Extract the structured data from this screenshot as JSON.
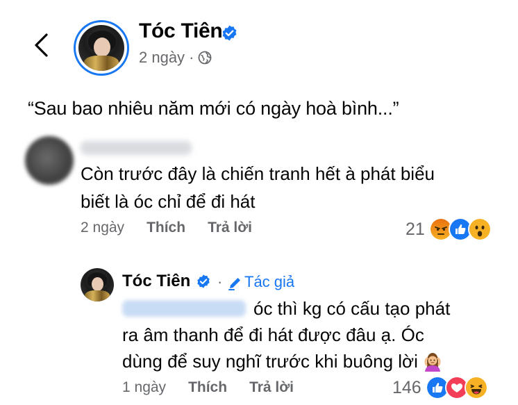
{
  "post": {
    "author": "Tóc Tiên",
    "time": "2 ngày",
    "separator": "·",
    "text": "“Sau bao nhiêu năm mới có ngày hoà bình...”"
  },
  "comments": [
    {
      "text_line1": "Còn trước đây là chiến tranh hết à phát biểu",
      "text_line2": "biết là óc chỉ để đi hát",
      "time": "2 ngày",
      "like_label": "Thích",
      "reply_label": "Trả lời",
      "reaction_count": "21",
      "reactions": [
        "angry-icon",
        "like-icon",
        "wow-icon"
      ]
    }
  ],
  "reply": {
    "author": "Tóc Tiên",
    "separator": "·",
    "badge": "Tác giả",
    "text_line1": "óc thì kg có cấu tạo phát",
    "text_line2": "ra âm thanh để đi hát được đâu ạ. Óc",
    "text_line3": "dùng để suy nghĩ trước khi buông lời",
    "time": "1 ngày",
    "like_label": "Thích",
    "reply_label": "Trả lời",
    "reaction_count": "146",
    "reactions": [
      "like-icon",
      "love-icon",
      "haha-icon"
    ]
  },
  "colors": {
    "accent": "#1877f2",
    "secondary_text": "#65676b",
    "primary_text": "#050505"
  }
}
